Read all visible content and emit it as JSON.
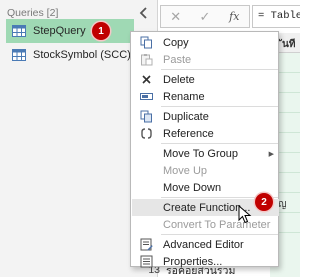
{
  "queries_pane": {
    "header": "Queries [2]",
    "items": [
      {
        "label": "StepQuery",
        "selected": true,
        "icon": "table-icon",
        "badge": "1"
      },
      {
        "label": "StockSymbol (SCC)",
        "selected": false,
        "icon": "table-icon"
      }
    ]
  },
  "formula_bar": {
    "cancel_icon": "close-icon",
    "commit_icon": "check-icon",
    "fx_label": "fx",
    "text": "= Table"
  },
  "grid": {
    "header_text": "ันที",
    "cell_text": "ญ",
    "last_row_number": "13",
    "last_row_text": "รอคอยส่วนรวม"
  },
  "context_menu": {
    "items": [
      {
        "label": "Copy",
        "icon": "copy-icon",
        "enabled": true
      },
      {
        "label": "Paste",
        "icon": "paste-icon",
        "enabled": false
      },
      {
        "label": "Delete",
        "icon": "delete-icon",
        "enabled": true
      },
      {
        "label": "Rename",
        "icon": "rename-icon",
        "enabled": true
      },
      {
        "label": "Duplicate",
        "icon": "duplicate-icon",
        "enabled": true
      },
      {
        "label": "Reference",
        "icon": "reference-icon",
        "enabled": true
      },
      {
        "label": "Move To Group",
        "enabled": true,
        "submenu": true
      },
      {
        "label": "Move Up",
        "enabled": false
      },
      {
        "label": "Move Down",
        "enabled": true
      },
      {
        "label": "Create Function...",
        "enabled": true,
        "hovered": true,
        "badge": "2"
      },
      {
        "label": "Convert To Parameter",
        "enabled": false
      },
      {
        "label": "Advanced Editor",
        "icon": "advanced-editor-icon",
        "enabled": true
      },
      {
        "label": "Properties...",
        "icon": "properties-icon",
        "enabled": true
      }
    ]
  },
  "colors": {
    "selected_query": "#9fd9b4",
    "badge": "#c00000",
    "menu_hover": "#e6e6e6"
  }
}
